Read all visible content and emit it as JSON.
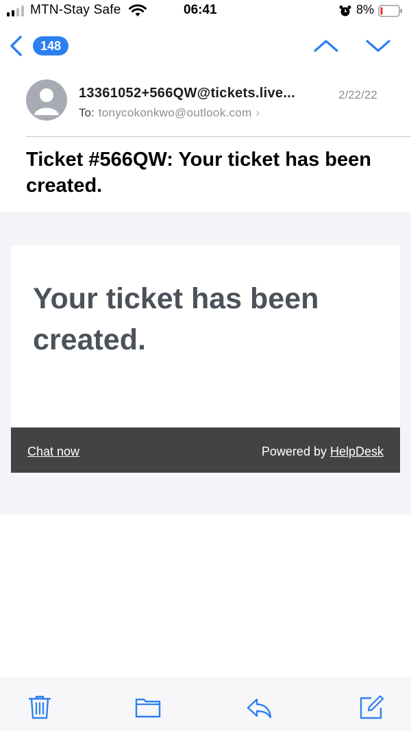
{
  "status_bar": {
    "carrier": "MTN-Stay Safe",
    "time": "06:41",
    "battery_percent": "8%",
    "icons": [
      "signal-icon",
      "wifi-icon",
      "alarm-icon",
      "battery-icon"
    ]
  },
  "nav": {
    "unread_count": "148",
    "icons": [
      "back-chevron-icon",
      "up-chevron-icon",
      "down-chevron-icon"
    ]
  },
  "message": {
    "sender": "13361052+566QW@tickets.live...",
    "date": "2/22/22",
    "to_label": "To:",
    "to_address": "tonycokonkwo@outlook.com",
    "subject": "Ticket #566QW: Your ticket has been created."
  },
  "email_body": {
    "heading": "Your ticket has been created.",
    "chat_link": "Chat now",
    "powered_by_prefix": "Powered by ",
    "powered_by_link": "HelpDesk"
  },
  "toolbar": {
    "icons": [
      "trash-icon",
      "folder-icon",
      "reply-icon",
      "compose-icon"
    ]
  },
  "colors": {
    "accent": "#2d7ff0",
    "footer_bar": "#434343",
    "heading_text": "#4c5259",
    "body_background": "#f3f4f8"
  }
}
